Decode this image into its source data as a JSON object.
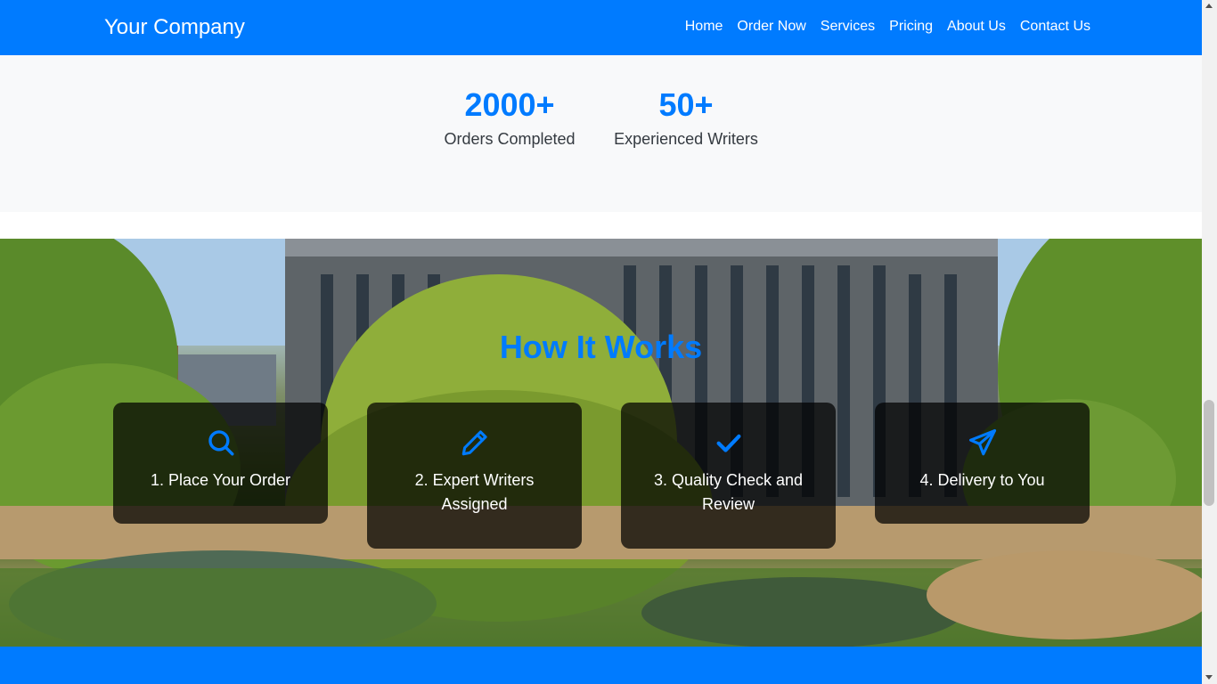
{
  "navbar": {
    "brand": "Your Company",
    "links": [
      "Home",
      "Order Now",
      "Services",
      "Pricing",
      "About Us",
      "Contact Us"
    ],
    "color": "#007bff"
  },
  "stats": [
    {
      "value": "2000+",
      "label": "Orders Completed"
    },
    {
      "value": "50+",
      "label": "Experienced Writers"
    }
  ],
  "how_it_works": {
    "title": "How It Works",
    "steps": [
      {
        "icon": "search-icon",
        "label": "1. Place Your Order"
      },
      {
        "icon": "pencil-icon",
        "label": "2. Expert Writers Assigned"
      },
      {
        "icon": "check-icon",
        "label": "3. Quality Check and Review"
      },
      {
        "icon": "paper-plane-icon",
        "label": "4. Delivery to You"
      }
    ]
  },
  "colors": {
    "accent": "#007bff",
    "stats_background": "#f8f9fa",
    "card_background": "rgba(0,0,0,0.72)"
  }
}
